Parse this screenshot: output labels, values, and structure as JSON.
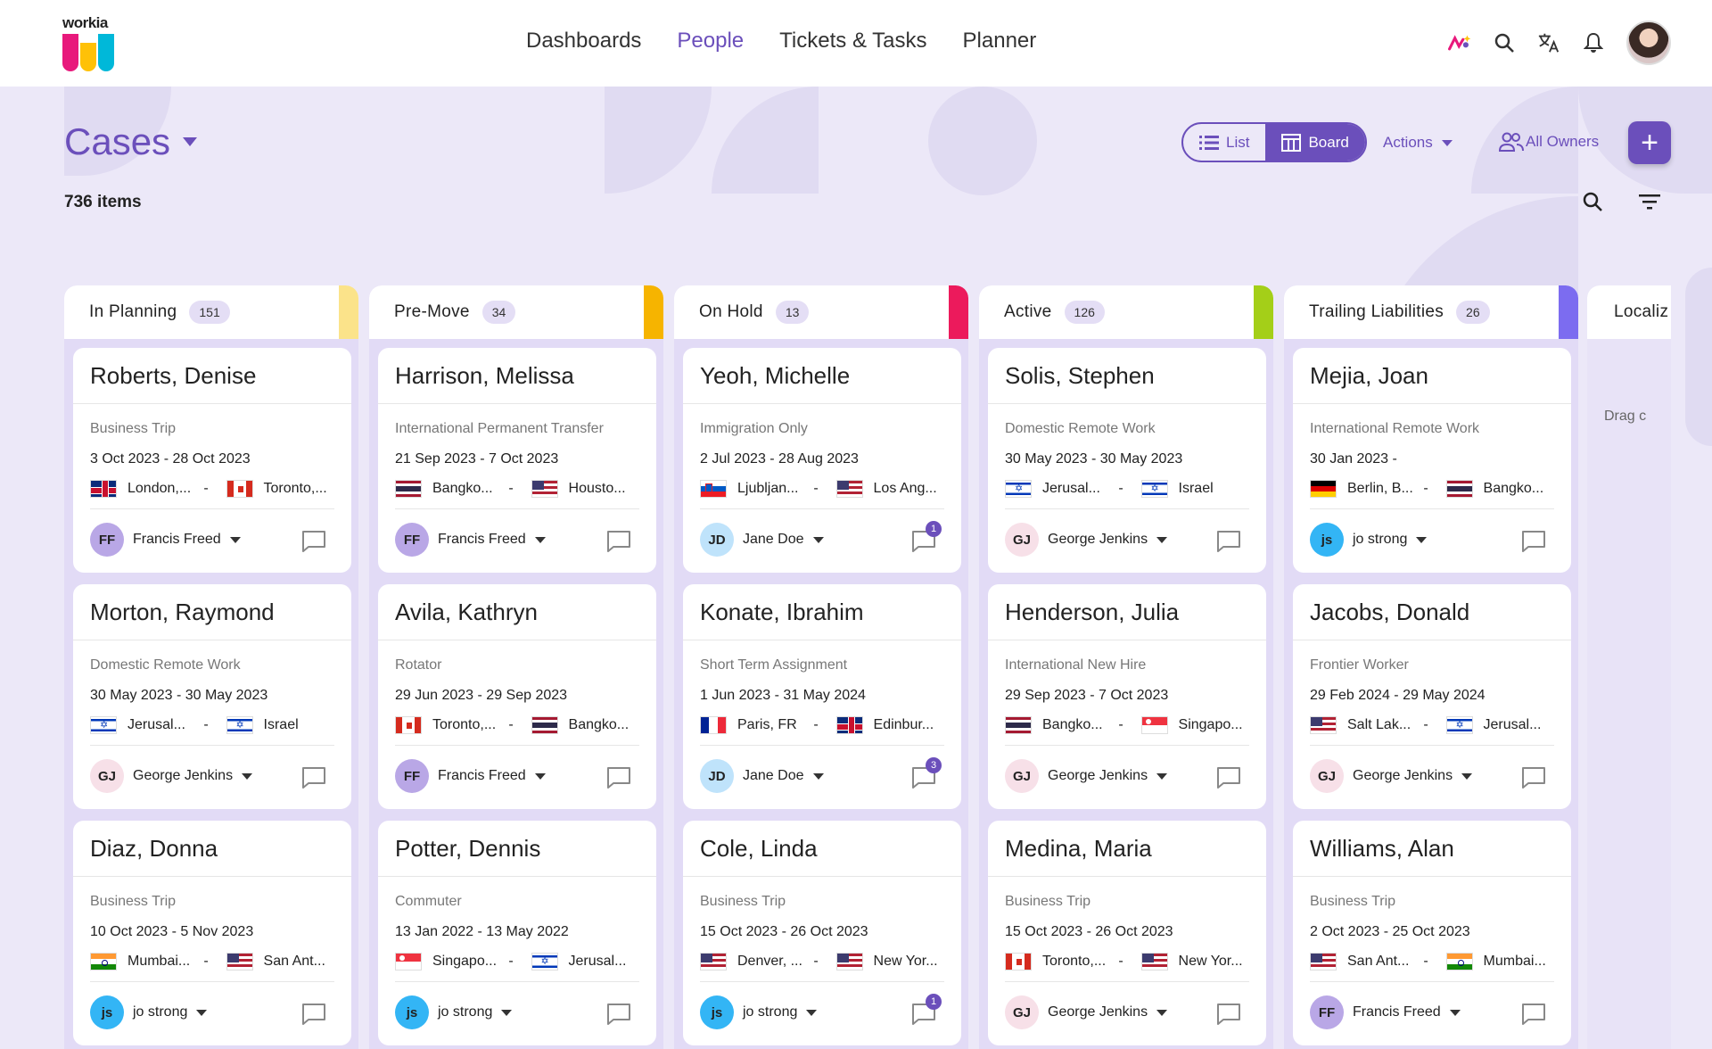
{
  "app": {
    "logo_text": "workia",
    "logo_colors": [
      "#e8197c",
      "#ffc107",
      "#00b8d9"
    ],
    "nav": [
      {
        "label": "Dashboards",
        "active": false
      },
      {
        "label": "People",
        "active": true
      },
      {
        "label": "Tickets & Tasks",
        "active": false
      },
      {
        "label": "Planner",
        "active": false
      }
    ],
    "icons": [
      "ai-sparkle-icon",
      "search-icon",
      "translate-icon",
      "bell-icon",
      "user-avatar"
    ]
  },
  "toolbar": {
    "title": "Cases",
    "count_label": "736 items",
    "view_list": "List",
    "view_board": "Board",
    "active_view": "Board",
    "actions_label": "Actions",
    "owners_label": "All Owners",
    "add_label": "+"
  },
  "colors": {
    "primary": "#6b4fbb",
    "background": "#ece8f8",
    "column": "#e2dbf6"
  },
  "columns": [
    {
      "title": "In Planning",
      "count": "151",
      "accent": "#fbe38a",
      "cards": [
        {
          "name": "Roberts, Denise",
          "type": "Business Trip",
          "dates": "3 Oct 2023 - 28 Oct 2023",
          "from": "London,...",
          "from_flag": "gb",
          "to": "Toronto,...",
          "to_flag": "ca",
          "owner": "Francis Freed",
          "initials": "FF",
          "avatar_color": "#b9a7e6",
          "comments": ""
        },
        {
          "name": "Morton, Raymond",
          "type": "Domestic Remote Work",
          "dates": "30 May 2023 - 30 May 2023",
          "from": "Jerusal...",
          "from_flag": "il",
          "to": "Israel",
          "to_flag": "il",
          "owner": "George Jenkins",
          "initials": "GJ",
          "avatar_color": "#f7e0e8",
          "comments": ""
        },
        {
          "name": "Diaz, Donna",
          "type": "Business Trip",
          "dates": "10 Oct 2023 - 5 Nov 2023",
          "from": "Mumbai...",
          "from_flag": "in",
          "to": "San Ant...",
          "to_flag": "us",
          "owner": "jo strong",
          "initials": "js",
          "avatar_color": "#33b5f5",
          "comments": ""
        }
      ]
    },
    {
      "title": "Pre-Move",
      "count": "34",
      "accent": "#f6b400",
      "cards": [
        {
          "name": "Harrison, Melissa",
          "type": "International Permanent Transfer",
          "dates": "21 Sep 2023 - 7 Oct 2023",
          "from": "Bangko...",
          "from_flag": "th",
          "to": "Housto...",
          "to_flag": "us",
          "owner": "Francis Freed",
          "initials": "FF",
          "avatar_color": "#b9a7e6",
          "comments": ""
        },
        {
          "name": "Avila, Kathryn",
          "type": "Rotator",
          "dates": "29 Jun 2023 - 29 Sep 2023",
          "from": "Toronto,...",
          "from_flag": "ca",
          "to": "Bangko...",
          "to_flag": "th",
          "owner": "Francis Freed",
          "initials": "FF",
          "avatar_color": "#b9a7e6",
          "comments": ""
        },
        {
          "name": "Potter, Dennis",
          "type": "Commuter",
          "dates": "13 Jan 2022 - 13 May 2022",
          "from": "Singapo...",
          "from_flag": "sg",
          "to": "Jerusal...",
          "to_flag": "il",
          "owner": "jo strong",
          "initials": "js",
          "avatar_color": "#33b5f5",
          "comments": ""
        }
      ]
    },
    {
      "title": "On Hold",
      "count": "13",
      "accent": "#ec1a5c",
      "cards": [
        {
          "name": "Yeoh, Michelle",
          "type": "Immigration Only",
          "dates": "2 Jul 2023 - 28 Aug 2023",
          "from": "Ljubljan...",
          "from_flag": "si",
          "to": "Los Ang...",
          "to_flag": "us",
          "owner": "Jane Doe",
          "initials": "JD",
          "avatar_color": "#bfe3fb",
          "comments": "1"
        },
        {
          "name": "Konate, Ibrahim",
          "type": "Short Term Assignment",
          "dates": "1 Jun 2023 - 31 May 2024",
          "from": "Paris, FR",
          "from_flag": "fr",
          "to": "Edinbur...",
          "to_flag": "gb",
          "owner": "Jane Doe",
          "initials": "JD",
          "avatar_color": "#bfe3fb",
          "comments": "3"
        },
        {
          "name": "Cole, Linda",
          "type": "Business Trip",
          "dates": "15 Oct 2023 - 26 Oct 2023",
          "from": "Denver, ...",
          "from_flag": "us",
          "to": "New Yor...",
          "to_flag": "us",
          "owner": "jo strong",
          "initials": "js",
          "avatar_color": "#33b5f5",
          "comments": "1"
        }
      ]
    },
    {
      "title": "Active",
      "count": "126",
      "accent": "#a4cf18",
      "cards": [
        {
          "name": "Solis, Stephen",
          "type": "Domestic Remote Work",
          "dates": "30 May 2023 - 30 May 2023",
          "from": "Jerusal...",
          "from_flag": "il",
          "to": "Israel",
          "to_flag": "il",
          "owner": "George Jenkins",
          "initials": "GJ",
          "avatar_color": "#f7e0e8",
          "comments": ""
        },
        {
          "name": "Henderson, Julia",
          "type": "International New Hire",
          "dates": "29 Sep 2023 - 7 Oct 2023",
          "from": "Bangko...",
          "from_flag": "th",
          "to": "Singapo...",
          "to_flag": "sg",
          "owner": "George Jenkins",
          "initials": "GJ",
          "avatar_color": "#f7e0e8",
          "comments": ""
        },
        {
          "name": "Medina, Maria",
          "type": "Business Trip",
          "dates": "15 Oct 2023 - 26 Oct 2023",
          "from": "Toronto,...",
          "from_flag": "ca",
          "to": "New Yor...",
          "to_flag": "us",
          "owner": "George Jenkins",
          "initials": "GJ",
          "avatar_color": "#f7e0e8",
          "comments": ""
        }
      ]
    },
    {
      "title": "Trailing Liabilities",
      "count": "26",
      "accent": "#7c6cf0",
      "cards": [
        {
          "name": "Mejia, Joan",
          "type": "International Remote Work",
          "dates": "30 Jan 2023 -",
          "from": "Berlin, B...",
          "from_flag": "de",
          "to": "Bangko...",
          "to_flag": "th",
          "owner": "jo strong",
          "initials": "js",
          "avatar_color": "#33b5f5",
          "comments": ""
        },
        {
          "name": "Jacobs, Donald",
          "type": "Frontier Worker",
          "dates": "29 Feb 2024 - 29 May 2024",
          "from": "Salt Lak...",
          "from_flag": "us",
          "to": "Jerusal...",
          "to_flag": "il",
          "owner": "George Jenkins",
          "initials": "GJ",
          "avatar_color": "#f7e0e8",
          "comments": ""
        },
        {
          "name": "Williams, Alan",
          "type": "Business Trip",
          "dates": "2 Oct 2023 - 25 Oct 2023",
          "from": "San Ant...",
          "from_flag": "us",
          "to": "Mumbai...",
          "to_flag": "in",
          "owner": "Francis Freed",
          "initials": "FF",
          "avatar_color": "#b9a7e6",
          "comments": ""
        }
      ]
    }
  ],
  "partial_column": {
    "title": "Localiz",
    "hint": "Drag c"
  }
}
